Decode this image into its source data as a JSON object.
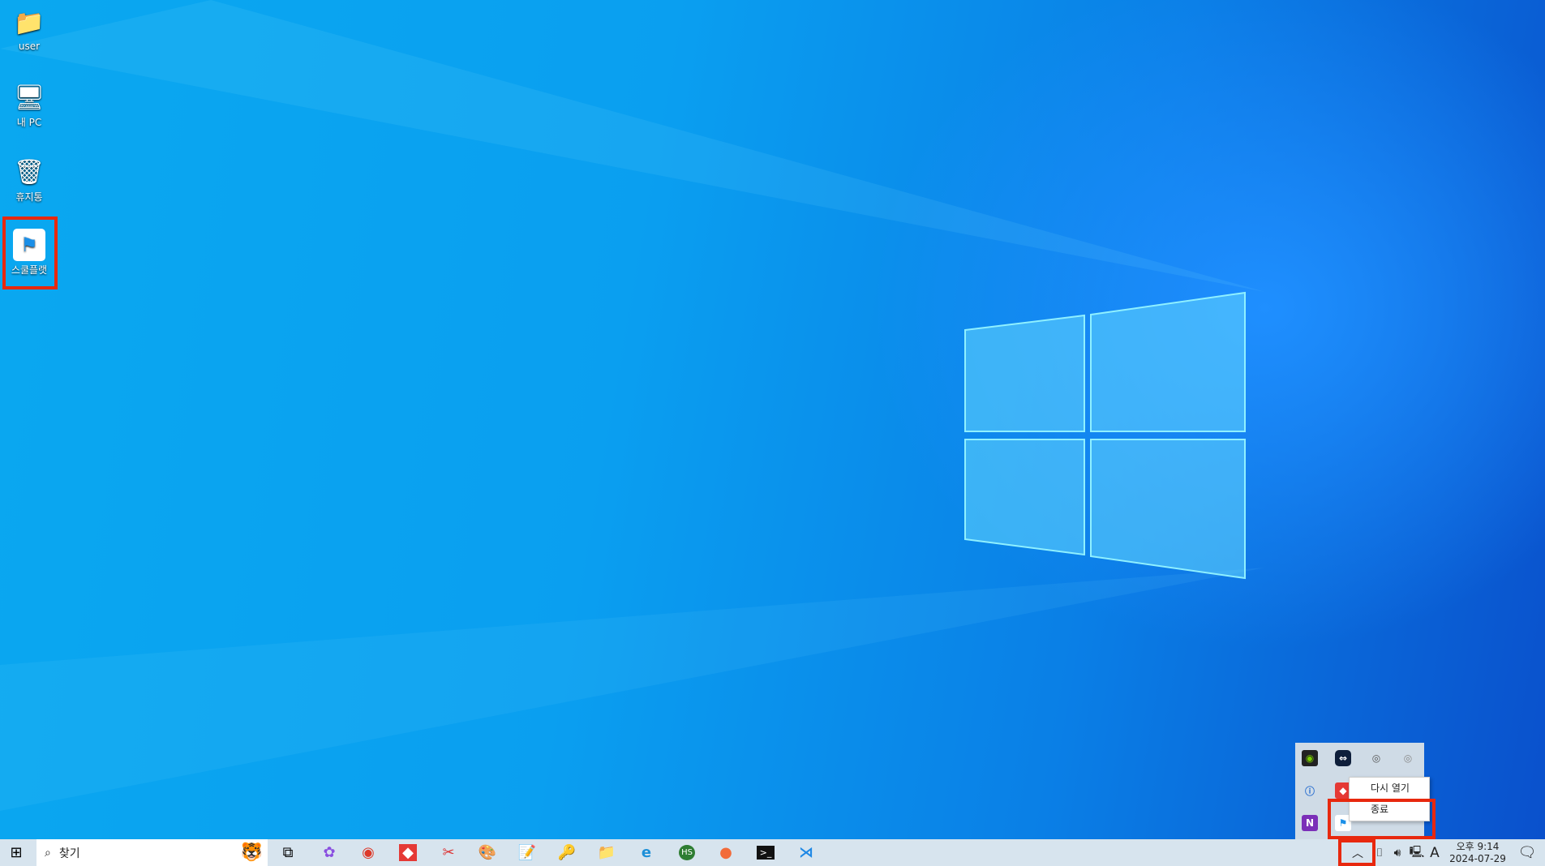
{
  "desktop": {
    "icons": [
      {
        "label": "user",
        "icon": "user-folder-icon"
      },
      {
        "label": "내 PC",
        "icon": "computer-icon"
      },
      {
        "label": "휴지통",
        "icon": "recycle-bin-icon"
      },
      {
        "label": "스쿨플랫",
        "icon": "schoolflat-shortcut-icon"
      }
    ]
  },
  "taskbar": {
    "search_placeholder": "찾기",
    "apps": [
      "copilot",
      "chrome",
      "app-red",
      "snipping-tool",
      "paint",
      "notepad",
      "network-tool",
      "file-explorer",
      "internet-explorer",
      "hs-app",
      "postman",
      "terminal",
      "vscode"
    ]
  },
  "tray_popup": {
    "icons": [
      "nvidia",
      "teamviewer",
      "update-alert",
      "ring-app",
      "network-help",
      "red-app",
      "onenote",
      "schoolflat"
    ]
  },
  "context_menu": {
    "items": [
      {
        "label": "다시 열기"
      },
      {
        "label": "종료"
      }
    ]
  },
  "clock": {
    "time": "오후 9:14",
    "date": "2024-07-29"
  },
  "ime": {
    "label": "A"
  },
  "colors": {
    "highlight": "#e8280e",
    "taskbar": "#d7e4ee"
  }
}
